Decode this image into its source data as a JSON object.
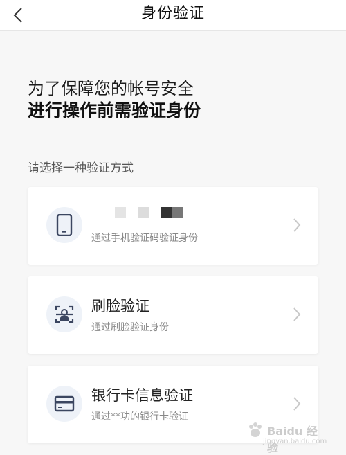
{
  "nav": {
    "title": "身份验证"
  },
  "intro": {
    "line1": "为了保障您的帐号安全",
    "line2": "进行操作前需验证身份"
  },
  "section_label": "请选择一种验证方式",
  "methods": [
    {
      "title": "",
      "subtitle": "通过手机验证码验证身份",
      "icon": "phone-icon"
    },
    {
      "title": "刷脸验证",
      "subtitle": "通过刷脸验证身份",
      "icon": "face-scan-icon"
    },
    {
      "title": "银行卡信息验证",
      "subtitle": "通过**功的银行卡验证",
      "icon": "bank-card-icon"
    }
  ],
  "watermark": {
    "main": "Baidu 经验",
    "sub": "jingyan.baidu.com"
  },
  "colors": {
    "icon_bg": "#eef2f8",
    "icon_fg": "#3b4660",
    "page_bg": "#f7f7f7"
  }
}
